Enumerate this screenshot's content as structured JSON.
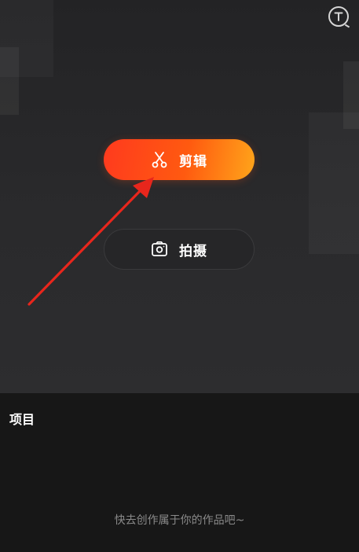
{
  "header": {
    "tutorial_icon": "tutorial-t-icon"
  },
  "actions": {
    "edit": {
      "label": "剪辑",
      "icon": "scissors-icon"
    },
    "shoot": {
      "label": "拍摄",
      "icon": "camera-icon"
    }
  },
  "annotation": {
    "arrow_color": "#e8261c",
    "points_to": "edit"
  },
  "projects": {
    "title": "项目",
    "empty_hint": "快去创作属于你的作品吧~"
  },
  "colors": {
    "accent_start": "#ff3a1e",
    "accent_end": "#ffa51a",
    "background": "#161616"
  }
}
